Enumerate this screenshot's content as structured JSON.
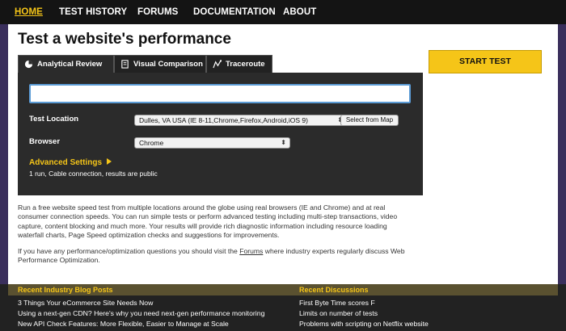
{
  "nav": [
    {
      "label": "Home",
      "active": true
    },
    {
      "label": "Test History",
      "active": false
    },
    {
      "label": "Forums",
      "active": false
    },
    {
      "label": "Documentation",
      "active": false
    },
    {
      "label": "About",
      "active": false
    }
  ],
  "page_title": "Test a website's performance",
  "tabs": [
    {
      "label": "Analytical Review",
      "icon": "pie-chart-icon",
      "active": true
    },
    {
      "label": "Visual Comparison",
      "icon": "document-icon",
      "active": false
    },
    {
      "label": "Traceroute",
      "icon": "traceroute-icon",
      "active": false
    }
  ],
  "form": {
    "url_value": "",
    "test_location_label": "Test Location",
    "test_location_value": "Dulles, VA USA (IE 8-11,Chrome,Firefox,Android,iOS 9)",
    "select_from_map": "Select from Map",
    "browser_label": "Browser",
    "browser_value": "Chrome",
    "advanced_settings": "Advanced Settings",
    "advanced_summary": "1 run, Cable connection, results are public"
  },
  "start_button": "Start Test",
  "description": {
    "para1": "Run a free website speed test from multiple locations around the globe using real browsers (IE and Chrome) and at real consumer connection speeds. You can run simple tests or perform advanced testing including multi-step transactions, video capture, content blocking and much more. Your results will provide rich diagnostic information including resource loading waterfall charts, Page Speed optimization checks and suggestions for improvements.",
    "para2_before": "If you have any performance/optimization questions you should visit the ",
    "para2_link": "Forums",
    "para2_after": " where industry experts regularly discuss Web Performance Optimization."
  },
  "footer": {
    "blog_heading": "Recent Industry Blog Posts",
    "blog_posts": [
      "3 Things Your eCommerce Site Needs Now",
      "Using a next-gen CDN? Here's why you need next-gen performance monitoring",
      "New API Check Features: More Flexible, Easier to Manage at Scale"
    ],
    "discussions_heading": "Recent Discussions",
    "discussions": [
      "First Byte Time scores F",
      "Limits on number of tests",
      "Problems with scripting on Netflix website"
    ]
  },
  "colors": {
    "accent": "#f5c518",
    "nav_bg": "#141414",
    "panel_bg": "#2b2b2b",
    "page_bg": "#3a2f5c"
  }
}
